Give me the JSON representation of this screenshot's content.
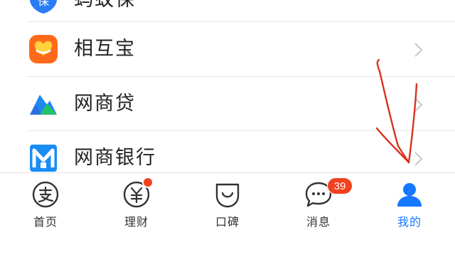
{
  "menu": {
    "items": [
      {
        "label": "蚂蚁保",
        "icon": "ant-insurance-icon"
      },
      {
        "label": "相互宝",
        "icon": "xianghubao-icon"
      },
      {
        "label": "网商贷",
        "icon": "mybank-loan-icon"
      },
      {
        "label": "网商银行",
        "icon": "mybank-icon"
      }
    ]
  },
  "tabbar": {
    "tabs": [
      {
        "label": "首页",
        "icon": "alipay-home-icon"
      },
      {
        "label": "理财",
        "icon": "wealth-yen-icon"
      },
      {
        "label": "口碑",
        "icon": "koubei-smile-icon"
      },
      {
        "label": "消息",
        "icon": "message-bubble-icon"
      },
      {
        "label": "我的",
        "icon": "user-profile-icon"
      }
    ],
    "active_index": 4,
    "message_badge": "39"
  },
  "colors": {
    "accent": "#1677ff",
    "badge": "#f2411d",
    "annotation": "#d8331f",
    "text": "#222222",
    "icon_gray": "#333333"
  }
}
